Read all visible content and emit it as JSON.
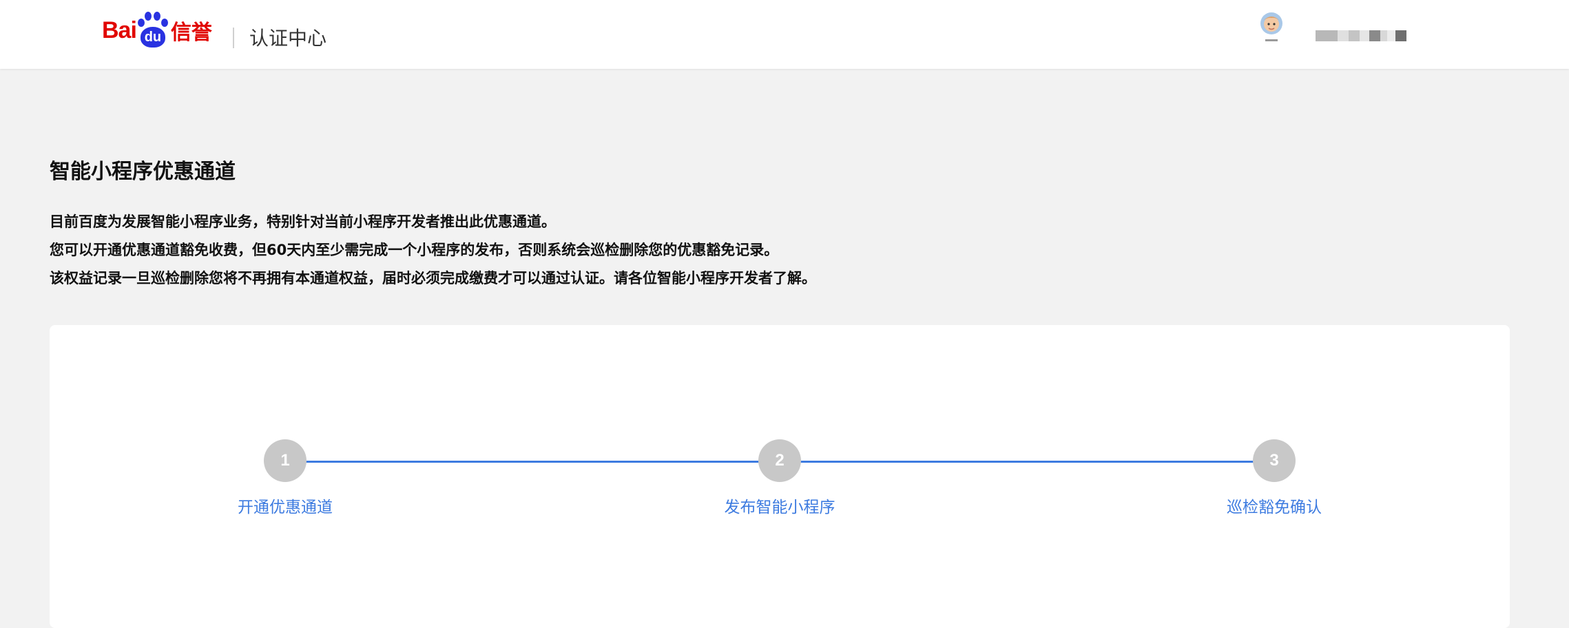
{
  "header": {
    "logo": {
      "text_bai": "Bai",
      "text_du": "du",
      "text_xinyu": "信誉",
      "color": "#e10601",
      "paw_color": "#2932e1"
    },
    "site_title": "认证中心",
    "avatar_icon": "user-avatar-icon"
  },
  "main": {
    "title": "智能小程序优惠通道",
    "intro": [
      "目前百度为发展智能小程序业务，特别针对当前小程序开发者推出此优惠通道。",
      "您可以开通优惠通道豁免收费，但60天内至少需完成一个小程序的发布，否则系统会巡检删除您的优惠豁免记录。",
      "该权益记录一旦巡检删除您将不再拥有本通道权益，届时必须完成缴费才可以通过认证。请各位智能小程序开发者了解。"
    ]
  },
  "steps": [
    {
      "number": "1",
      "label": "开通优惠通道"
    },
    {
      "number": "2",
      "label": "发布智能小程序"
    },
    {
      "number": "3",
      "label": "巡检豁免确认"
    }
  ],
  "colors": {
    "accent": "#3d7be0",
    "step_inactive": "#c8c8c8",
    "page_bg": "#f2f2f2"
  }
}
